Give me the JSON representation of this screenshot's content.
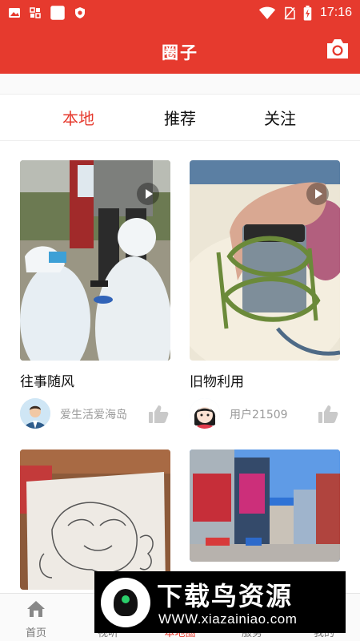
{
  "status_bar": {
    "time": "17:16"
  },
  "app_bar": {
    "title": "圈子"
  },
  "tabs": [
    {
      "label": "本地",
      "active": true
    },
    {
      "label": "推荐",
      "active": false
    },
    {
      "label": "关注",
      "active": false
    }
  ],
  "cards": [
    {
      "title": "往事随风",
      "user": "爱生活爱海岛",
      "has_video": true
    },
    {
      "title": "旧物利用",
      "user": "用户21509",
      "has_video": true
    },
    {
      "title": "",
      "user": "",
      "has_video": false
    },
    {
      "title": "",
      "user": "",
      "has_video": false
    }
  ],
  "bottom_nav": [
    {
      "label": "首页",
      "active": false
    },
    {
      "label": "视听",
      "active": false
    },
    {
      "label": "本地圈",
      "active": true
    },
    {
      "label": "服务",
      "active": false
    },
    {
      "label": "我的",
      "active": false
    }
  ],
  "watermark": {
    "brand": "下载鸟资源",
    "url": "WWW.xiazainiao.com"
  },
  "colors": {
    "accent": "#e63a2e",
    "muted_text": "#9a9a9a"
  }
}
